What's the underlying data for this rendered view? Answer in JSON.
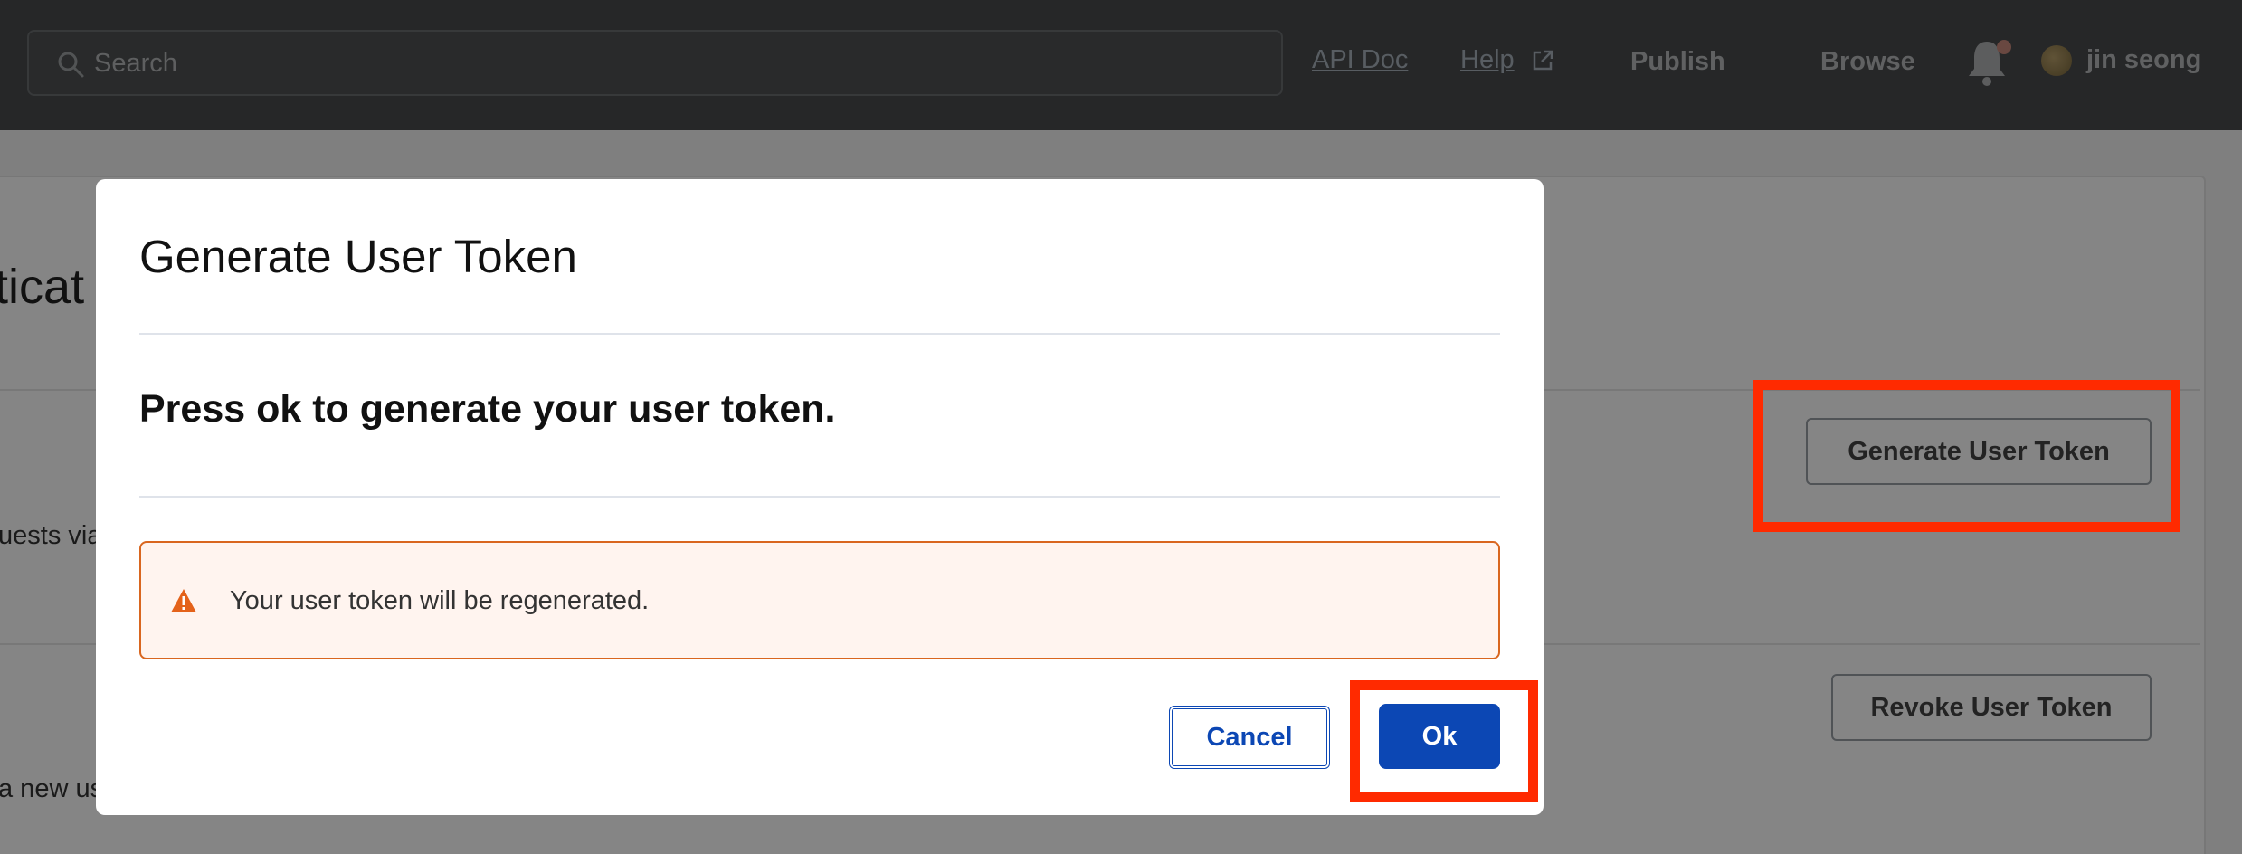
{
  "topbar": {
    "search_placeholder": "Search",
    "links": {
      "api_doc": "API Doc",
      "help": "Help"
    },
    "publish_label": "Publish",
    "browse_label": "Browse",
    "user_name": "jin seong"
  },
  "page": {
    "section_title": "nticat",
    "row1_text": "uests via",
    "row2_text": "a new use",
    "generate_button_label": "Generate User Token",
    "revoke_button_label": "Revoke User Token"
  },
  "modal": {
    "title": "Generate User Token",
    "message": "Press ok to generate your user token.",
    "alert_text": "Your user token will be regenerated.",
    "cancel_label": "Cancel",
    "ok_label": "Ok"
  },
  "colors": {
    "topbar": "#4a4c4e",
    "primary": "#0c47b4",
    "warning": "#d9661f",
    "annotation_red": "#ff2a00"
  }
}
